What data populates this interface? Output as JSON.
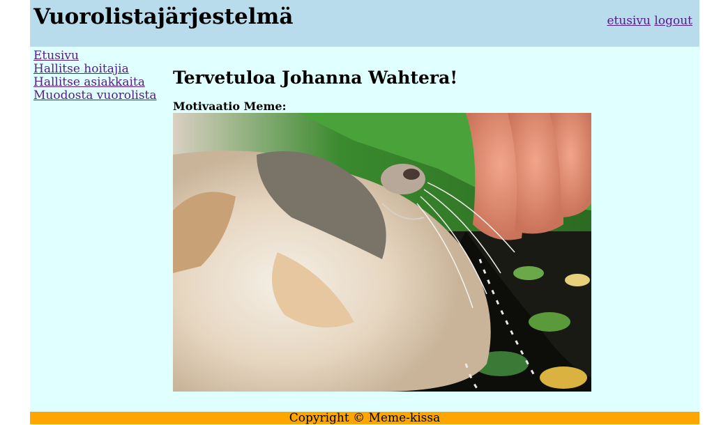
{
  "header": {
    "title": "Vuorolistajärjestelmä",
    "links": {
      "home": "etusivu",
      "logout": "logout"
    }
  },
  "sidebar": {
    "items": [
      {
        "label": "Etusivu"
      },
      {
        "label": "Hallitse hoitajia"
      },
      {
        "label": "Hallitse asiakkaita"
      },
      {
        "label": "Muodosta vuorolista"
      }
    ]
  },
  "main": {
    "welcome": "Tervetuloa Johanna Wahtera!",
    "meme_label": "Motivaatio Meme:"
  },
  "footer": {
    "copyright": "Copyright © Meme-kissa"
  },
  "colors": {
    "header_bg": "#b8dceb",
    "page_bg": "#e0ffff",
    "footer_bg": "#ffa500",
    "link": "#551a8b"
  }
}
